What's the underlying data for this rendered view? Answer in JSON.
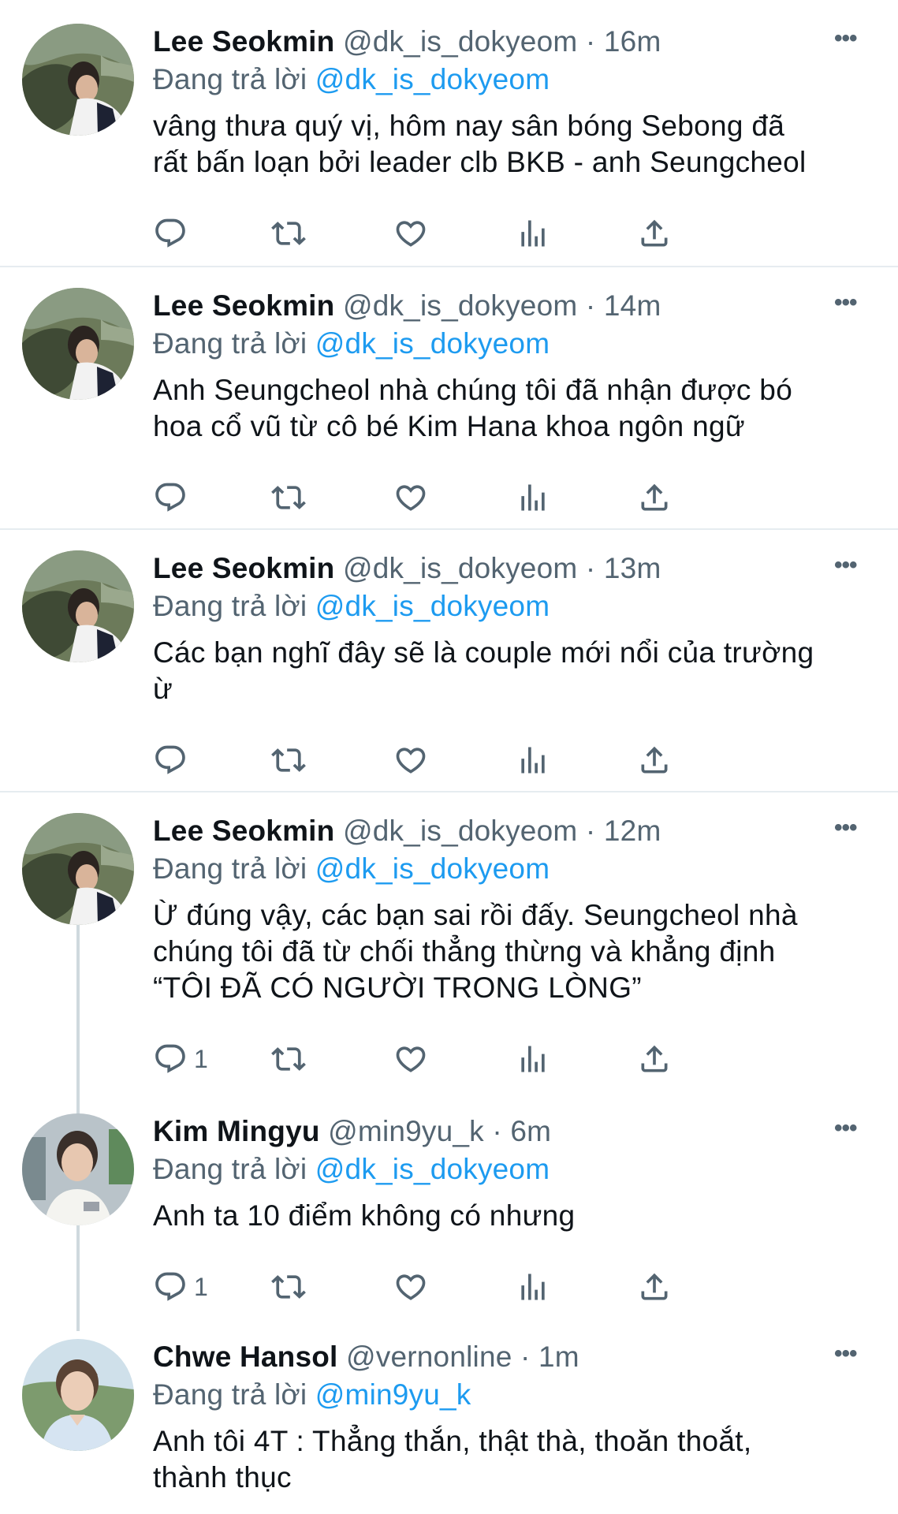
{
  "tweets": [
    {
      "name": "Lee Seokmin",
      "handle": "@dk_is_dokyeom",
      "dot": "·",
      "time": "16m",
      "reply_prefix": "Đang trả lời",
      "reply_to": "@dk_is_dokyeom",
      "lines": [
        "vâng thưa quý vị, hôm nay sân bóng Sebong đã",
        "rất bấn loạn bởi leader clb BKB - anh Seungcheol"
      ],
      "reply_count": "",
      "avatar": "seokmin-avatar"
    },
    {
      "name": "Lee Seokmin",
      "handle": "@dk_is_dokyeom",
      "dot": "·",
      "time": "14m",
      "reply_prefix": "Đang trả lời",
      "reply_to": "@dk_is_dokyeom",
      "lines": [
        "Anh Seungcheol nhà chúng tôi đã nhận được bó",
        "hoa cổ vũ từ cô bé Kim Hana khoa ngôn ngữ"
      ],
      "reply_count": "",
      "avatar": "seokmin-avatar"
    },
    {
      "name": "Lee Seokmin",
      "handle": "@dk_is_dokyeom",
      "dot": "·",
      "time": "13m",
      "reply_prefix": "Đang trả lời",
      "reply_to": "@dk_is_dokyeom",
      "lines": [
        "Các bạn nghĩ đây sẽ là couple mới nổi của trường",
        "ừ"
      ],
      "reply_count": "",
      "avatar": "seokmin-avatar"
    },
    {
      "name": "Lee Seokmin",
      "handle": "@dk_is_dokyeom",
      "dot": "·",
      "time": "12m",
      "reply_prefix": "Đang trả lời",
      "reply_to": "@dk_is_dokyeom",
      "lines": [
        "Ừ đúng vậy, các bạn sai rồi đấy. Seungcheol nhà",
        "chúng tôi đã từ chối thẳng thừng và khẳng định",
        "“TÔI ĐÃ CÓ NGƯỜI TRONG LÒNG”"
      ],
      "reply_count": "1",
      "avatar": "seokmin-avatar"
    },
    {
      "name": "Kim Mingyu",
      "handle": "@min9yu_k",
      "dot": "·",
      "time": "6m",
      "reply_prefix": "Đang trả lời",
      "reply_to": "@dk_is_dokyeom",
      "lines": [
        "Anh ta 10 điểm không có nhưng"
      ],
      "reply_count": "1",
      "avatar": "mingyu-avatar"
    },
    {
      "name": "Chwe Hansol",
      "handle": "@vernonline",
      "dot": "·",
      "time": "1m",
      "reply_prefix": "Đang trả lời",
      "reply_to": "@min9yu_k",
      "lines": [
        "Anh tôi 4T : Thẳng thắn, thật thà, thoăn thoắt,",
        "thành thục"
      ],
      "reply_count": "",
      "avatar": "hansol-avatar"
    }
  ],
  "more_label": "•••",
  "colors": {
    "accent": "#1d9bf0",
    "secondary": "#536471",
    "text": "#0f1419",
    "separator": "#e6ecf0"
  },
  "action_icons": [
    "reply-icon",
    "retweet-icon",
    "like-icon",
    "analytics-icon",
    "share-icon"
  ]
}
